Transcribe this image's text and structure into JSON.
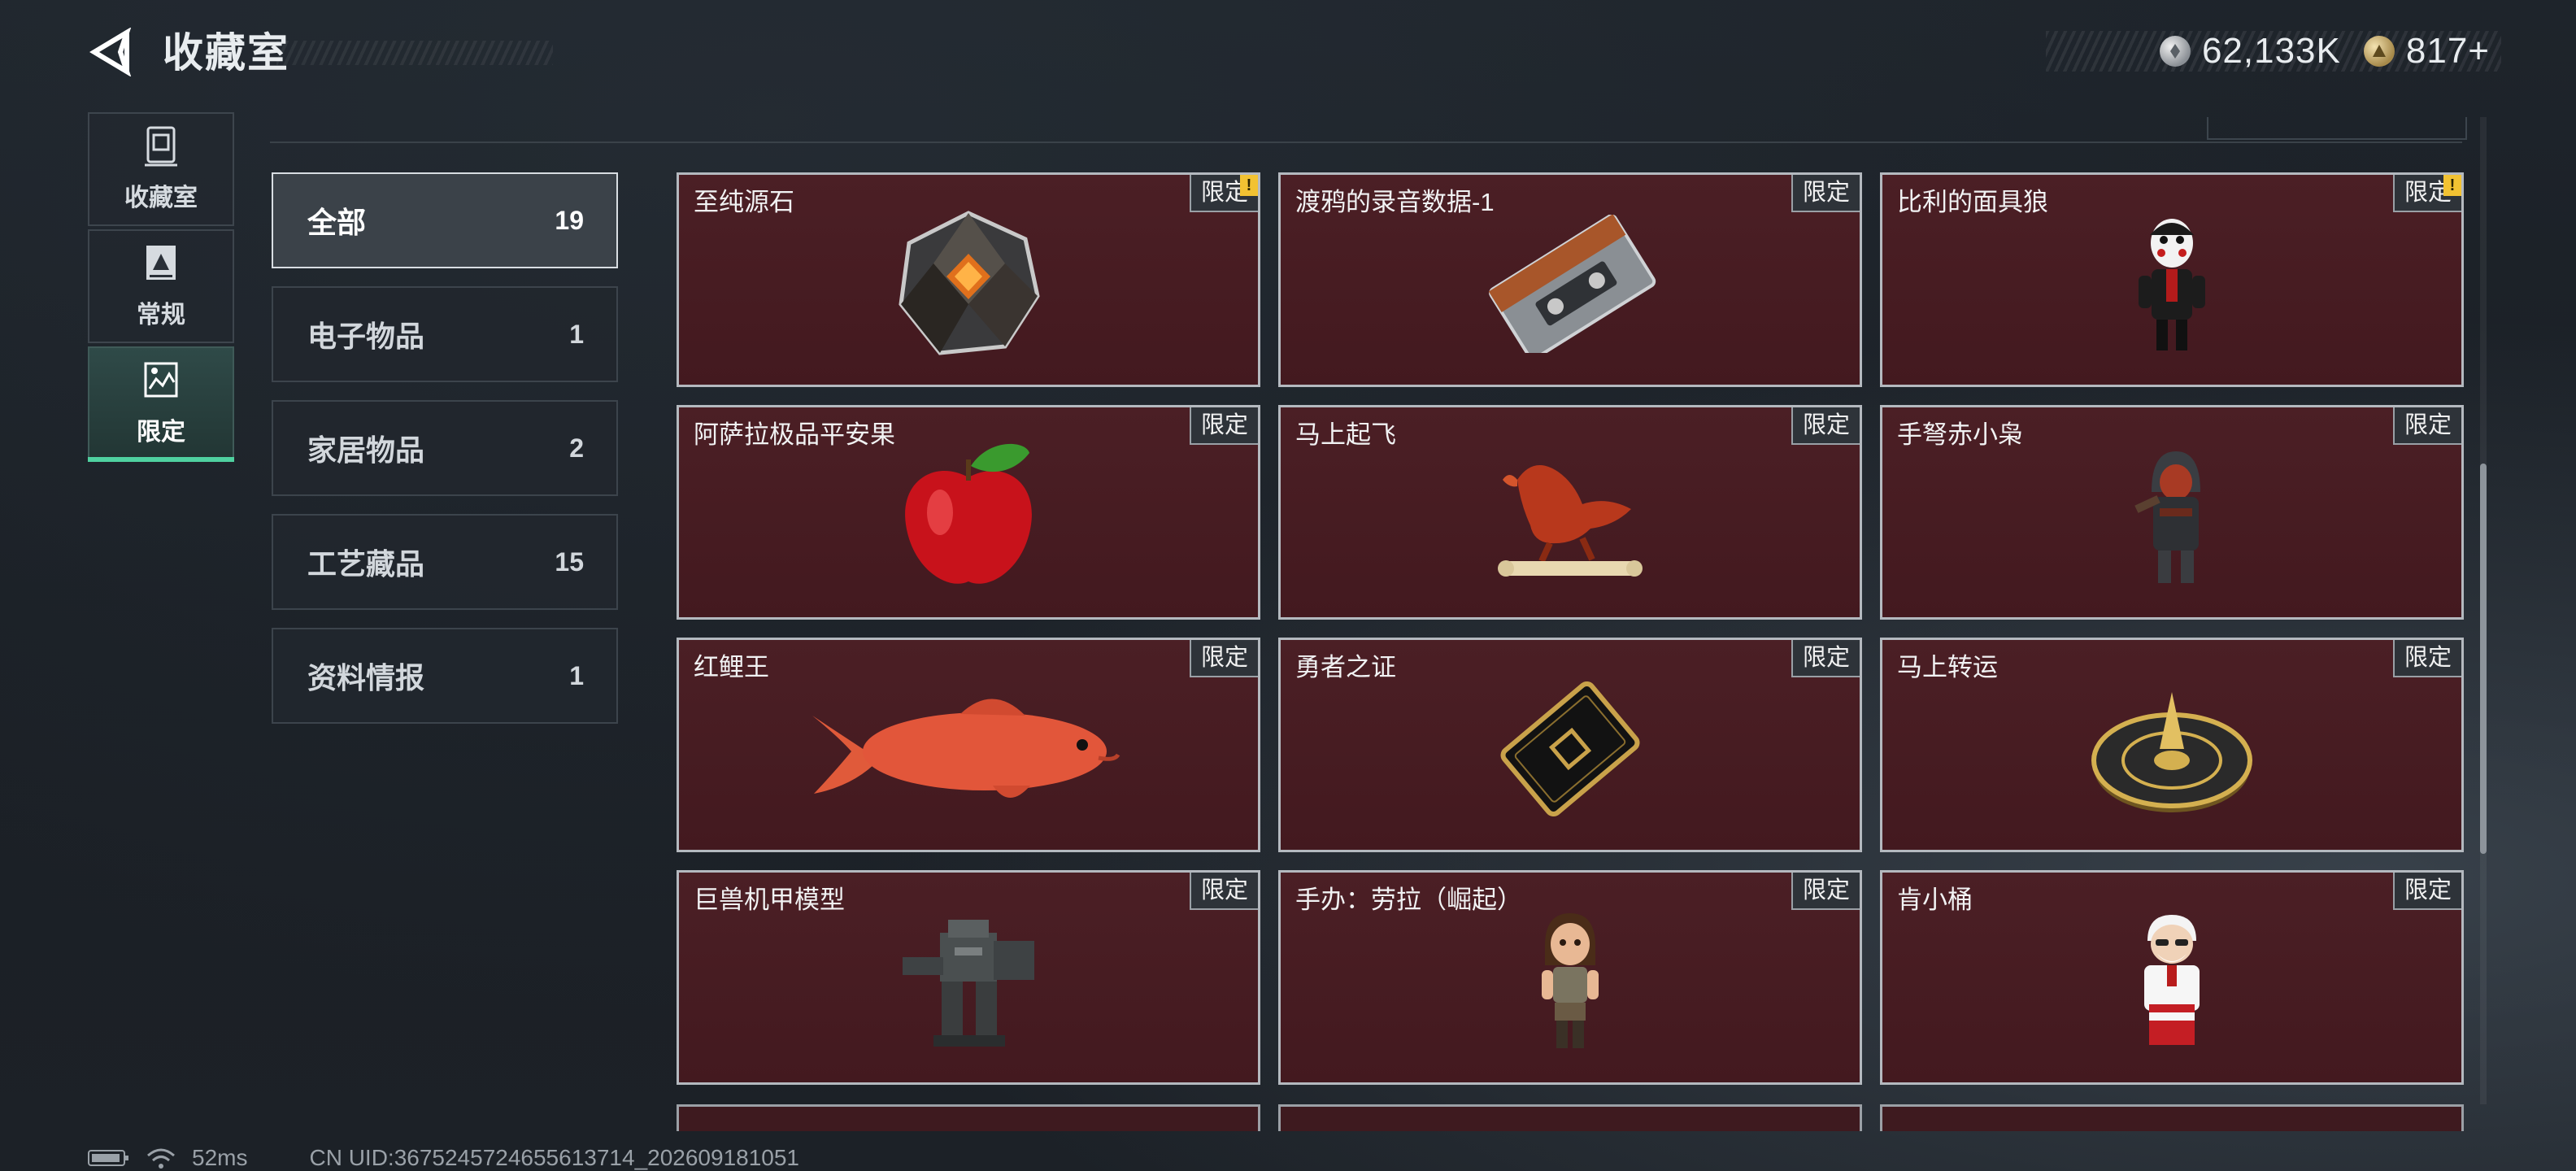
{
  "header": {
    "title": "收藏室"
  },
  "currency": {
    "silver": "62,133K",
    "gold": "817+"
  },
  "side_nav": [
    {
      "label": "收藏室",
      "icon": "showcase-icon",
      "active": false
    },
    {
      "label": "常规",
      "icon": "regular-icon",
      "active": false
    },
    {
      "label": "限定",
      "icon": "limited-icon",
      "active": true
    }
  ],
  "categories": [
    {
      "label": "全部",
      "count": "19",
      "active": true
    },
    {
      "label": "电子物品",
      "count": "1",
      "active": false
    },
    {
      "label": "家居物品",
      "count": "2",
      "active": false
    },
    {
      "label": "工艺藏品",
      "count": "15",
      "active": false
    },
    {
      "label": "资料情报",
      "count": "1",
      "active": false
    }
  ],
  "items": [
    {
      "name": "至纯源石",
      "badge": "限定",
      "alert": true,
      "icon": "crystal-icon"
    },
    {
      "name": "渡鸦的录音数据-1",
      "badge": "限定",
      "alert": false,
      "icon": "cassette-icon"
    },
    {
      "name": "比利的面具狼",
      "badge": "限定",
      "alert": true,
      "icon": "puppet-figure-icon"
    },
    {
      "name": "阿萨拉极品平安果",
      "badge": "限定",
      "alert": false,
      "icon": "apple-icon"
    },
    {
      "name": "马上起飞",
      "badge": "限定",
      "alert": false,
      "icon": "horse-sculpture-icon"
    },
    {
      "name": "手弩赤小枭",
      "badge": "限定",
      "alert": false,
      "icon": "hooded-figure-icon"
    },
    {
      "name": "红鲤王",
      "badge": "限定",
      "alert": false,
      "icon": "carp-icon"
    },
    {
      "name": "勇者之证",
      "badge": "限定",
      "alert": false,
      "icon": "card-icon"
    },
    {
      "name": "马上转运",
      "badge": "限定",
      "alert": false,
      "icon": "compass-disc-icon"
    },
    {
      "name": "巨兽机甲模型",
      "badge": "限定",
      "alert": false,
      "icon": "mech-icon"
    },
    {
      "name": "手办：劳拉（崛起）",
      "badge": "限定",
      "alert": false,
      "icon": "lara-figure-icon"
    },
    {
      "name": "肯小桶",
      "badge": "限定",
      "alert": false,
      "icon": "colonel-figure-icon"
    }
  ],
  "status": {
    "ping": "52ms",
    "uid": "CN UID:3675245724655613714_202609181051"
  },
  "colors": {
    "card_bg": "#461b21",
    "accent": "#4fd1a0",
    "alert": "#f2c232"
  }
}
